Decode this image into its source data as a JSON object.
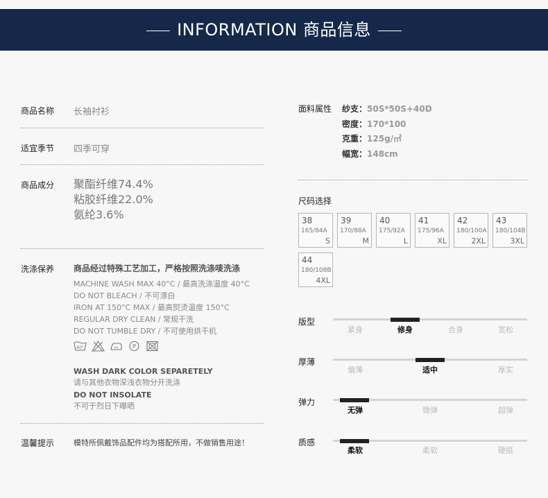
{
  "header": {
    "title": "INFORMATION 商品信息"
  },
  "info": {
    "name_label": "商品名称",
    "name_value": "长袖衬衫",
    "season_label": "适宜季节",
    "season_value": "四季可穿",
    "composition_label": "商品成分",
    "composition": [
      "聚酯纤维74.4%",
      "粘胶纤维22.0%",
      "氨纶3.6%"
    ],
    "care_label": "洗涤保养",
    "care_title": "商品经过特殊工艺加工，严格按照洗涤唛洗涤",
    "care_lines": [
      "MACHINE WASH MAX 40°C / 最高洗涤温度 40°C",
      "DO NOT BLEACH / 不可漂白",
      "IRON AT 150°C MAX / 最高熨烫温度 150°C",
      "REGULAR DRY CLEAN / 常规干洗",
      "DO NOT TUMBLE DRY / 不可使用烘干机"
    ],
    "care_icons": [
      "wash-40-icon",
      "no-bleach-icon",
      "iron-icon",
      "dry-clean-p-icon",
      "no-tumble-dry-icon"
    ],
    "wash_icon_text": "40°",
    "dry_clean_icon_text": "P",
    "wash_dark_en": "WASH DARK COLOR SEPARETELY",
    "wash_dark_cn": "请与其他衣物深浅衣物分开洗涤",
    "no_insolate_en": "DO NOT INSOLATE",
    "no_insolate_cn": "不可于烈日下曝晒",
    "tip_label": "温馨提示",
    "tip_value": "模特所佩戴饰品配件均为搭配所用，不做销售用途！"
  },
  "fabric": {
    "label": "面料属性",
    "rows": [
      {
        "key": "纱支：",
        "value": "50S*50S+40D"
      },
      {
        "key": "密度：",
        "value": "170*100"
      },
      {
        "key": "克重：",
        "value": "125g/㎡"
      },
      {
        "key": "幅宽：",
        "value": "148cm"
      }
    ]
  },
  "sizes": {
    "label": "尺码选择",
    "items": [
      {
        "num": "38",
        "dim": "165/84A",
        "letter": "S"
      },
      {
        "num": "39",
        "dim": "170/88A",
        "letter": "M"
      },
      {
        "num": "40",
        "dim": "175/92A",
        "letter": "L"
      },
      {
        "num": "41",
        "dim": "175/96A",
        "letter": "XL"
      },
      {
        "num": "42",
        "dim": "180/100A",
        "letter": "2XL"
      },
      {
        "num": "43",
        "dim": "180/104B",
        "letter": "3XL"
      },
      {
        "num": "44",
        "dim": "180/108B",
        "letter": "4XL"
      }
    ]
  },
  "attributes": [
    {
      "label": "版型",
      "options": [
        "紧身",
        "修身",
        "合身",
        "宽松"
      ],
      "selected": 1
    },
    {
      "label": "厚薄",
      "options": [
        "偏薄",
        "适中",
        "厚实"
      ],
      "selected": 1
    },
    {
      "label": "弹力",
      "options": [
        "无弹",
        "微弹",
        "超弹"
      ],
      "selected": 0
    },
    {
      "label": "质感",
      "options": [
        "柔软",
        "柔软",
        "硬挺"
      ],
      "selected": 0
    }
  ],
  "colors": {
    "banner": "#15284a",
    "marker": "#222222",
    "track": "#d4d4d4"
  }
}
